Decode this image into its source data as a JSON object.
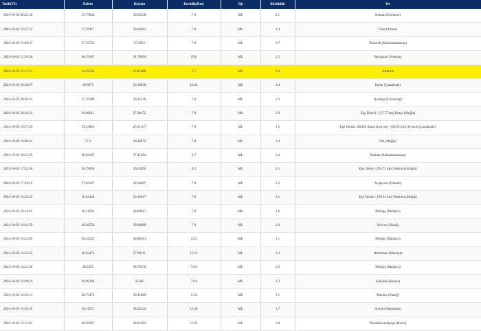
{
  "table": {
    "headers": {
      "ts": "Tarih(TS)",
      "lat": "Enlem",
      "lon": "Boylam",
      "depth": "Derinlik(Km)",
      "type": "Tip",
      "mag": "Büyüklük",
      "place": "Yer"
    },
    "highlight_color": "#fcef00",
    "header_color": "#0b2d63",
    "rows": [
      {
        "ts": "2024-10-04 00:42:36",
        "lat": "39.79944",
        "lon": "39.05528",
        "depth": "7.0",
        "type": "ML",
        "mag": "2.1",
        "place": "Kemah (Erzincan)"
      },
      {
        "ts": "2024-10-03 22:17:52",
        "lat": "37.78417",
        "lon": "36.04361",
        "depth": "7.0",
        "type": "ML",
        "mag": "1.4",
        "place": "Feke (Adana)"
      },
      {
        "ts": "2024-10-03 21:49:37",
        "lat": "37.55722",
        "lon": "37.2925",
        "depth": "7.0",
        "type": "ML",
        "mag": "1.7",
        "place": "Pazarcık (Kahramanmaraş)"
      },
      {
        "ts": "2024-10-03 21:36:46",
        "lat": "40.19167",
        "lon": "31.70694",
        "depth": "29.6",
        "type": "ML",
        "mag": "2.2",
        "place": "Beypazarı (Ankara)"
      },
      {
        "ts": "2024-10-03 21:17:15",
        "lat": "34.92528",
        "lon": "25.61889",
        "depth": "5.7",
        "type": "ML",
        "mag": "3.2",
        "place": "Akdeniz",
        "highlight": true
      },
      {
        "ts": "2024-10-03 20:38:07",
        "lat": "39.6875",
        "lon": "26.38028",
        "depth": "12.94",
        "type": "ML",
        "mag": "1.4",
        "place": "Ezine (Çanakkale)"
      },
      {
        "ts": "2024-10-03 20:36:41",
        "lat": "37.19389",
        "lon": "36.95139",
        "depth": "7.0",
        "type": "ML",
        "mag": "1.3",
        "place": "Nurdağı (Gaziantep)"
      },
      {
        "ts": "2024-10-03 20:16:54",
        "lat": "36.80611",
        "lon": "27.30472",
        "depth": "7.0",
        "type": "ML",
        "mag": "1.9",
        "place": "Ege Denizi - [17.77 km] Datça (Muğla)"
      },
      {
        "ts": "2024-10-03 19:57:29",
        "lat": "39.23861",
        "lon": "26.21167",
        "depth": "7.0",
        "type": "ML",
        "mag": "1.5",
        "place": "Ege Denizi, Midilli Adası (Lesvos) - [28.52 km] Ayvacık (Çanakkale)"
      },
      {
        "ts": "2024-10-03 19:00:41",
        "lat": "37.1",
        "lon": "28.42972",
        "depth": "7.0",
        "type": "ML",
        "mag": "1.4",
        "place": "Ula (Muğla)"
      },
      {
        "ts": "2024-10-03 18:51:59",
        "lat": "38.02167",
        "lon": "37.41694",
        "depth": "6.7",
        "type": "ML",
        "mag": "1.4",
        "place": "Nurhak (Kahramanmaraş)"
      },
      {
        "ts": "2024-10-03 17:43:50",
        "lat": "36.79056",
        "lon": "26.23056",
        "depth": "8.2",
        "type": "ML",
        "mag": "2.1",
        "place": "Ege Denizi - [94.73 km] Bodrum (Muğla)"
      },
      {
        "ts": "2024-10-03 17:23:16",
        "lat": "37.29167",
        "lon": "29.34667",
        "depth": "7.0",
        "type": "ML",
        "mag": "1.3",
        "place": "Acıpayam (Denizli)"
      },
      {
        "ts": "2024-10-03 16:23:52",
        "lat": "36.84444",
        "lon": "26.19417",
        "depth": "7.0",
        "type": "ML",
        "mag": "2.1",
        "place": "Ege Denizi - [96.54 km] Bodrum (Muğla)"
      },
      {
        "ts": "2024-10-03 16:14:11",
        "lat": "38.21833",
        "lon": "38.69917",
        "depth": "7.0",
        "type": "ML",
        "mag": "1.6",
        "place": "Pütürge (Malatya)"
      },
      {
        "ts": "2024-10-03 16:01:59",
        "lat": "38.38556",
        "lon": "39.06889",
        "depth": "7.0",
        "type": "ML",
        "mag": "2.0",
        "place": "Sivrice (Elazığ)"
      },
      {
        "ts": "2024-10-03 15:53:05",
        "lat": "38.22222",
        "lon": "38.80361",
        "depth": "13.5",
        "type": "ML",
        "mag": "1.1",
        "place": "Pütürge (Malatya)"
      },
      {
        "ts": "2024-10-03 14:52:52",
        "lat": "38.82472",
        "lon": "37.99111",
        "depth": "15.13",
        "type": "ML",
        "mag": "1.2",
        "place": "Hekimhan (Malatya)"
      },
      {
        "ts": "2024-10-03 14:41:58",
        "lat": "38.2225",
        "lon": "38.70556",
        "depth": "7.04",
        "type": "ML",
        "mag": "1.9",
        "place": "Pütürge (Malatya)"
      },
      {
        "ts": "2024-10-03 14:29:19",
        "lat": "38.09194",
        "lon": "32.605",
        "depth": "7.04",
        "type": "ML",
        "mag": "1.3",
        "place": "Selçuklu (Konya)"
      },
      {
        "ts": "2024-10-03 14:02:14",
        "lat": "38.73472",
        "lon": "39.21889",
        "depth": "1.54",
        "type": "ML",
        "mag": "1.1",
        "place": "Merkez (Elazığ)"
      },
      {
        "ts": "2024-10-03 13:56:45",
        "lat": "38.11972",
        "lon": "38.52444",
        "depth": "12.49",
        "type": "ML",
        "mag": "1.7",
        "place": "Sincik (Adıyaman)"
      },
      {
        "ts": "2024-10-03 13:31:01",
        "lat": "40.05667",
        "lon": "28.61083",
        "depth": "11.93",
        "type": "ML",
        "mag": "1.8",
        "place": "Mustafakemalpaşa (Bursa)"
      }
    ]
  }
}
